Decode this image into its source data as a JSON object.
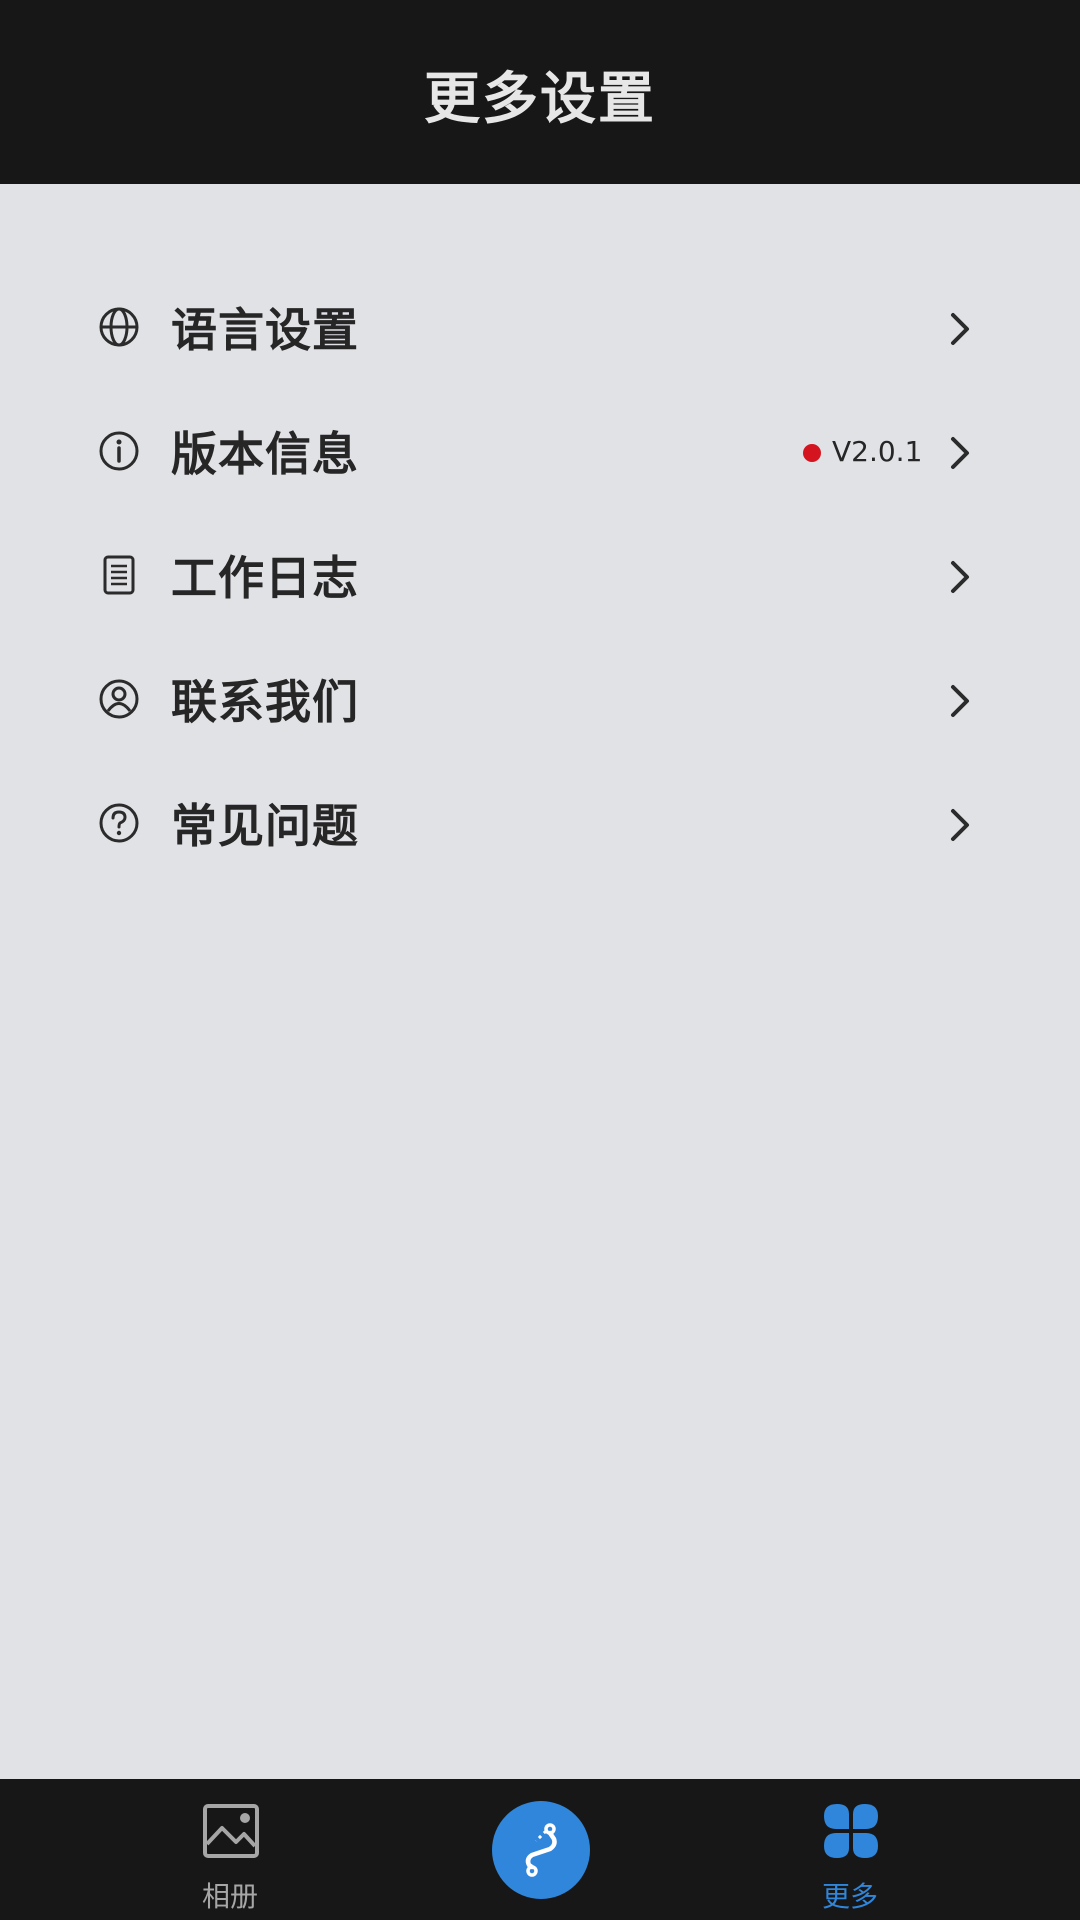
{
  "header": {
    "title": "更多设置"
  },
  "menu": {
    "items": [
      {
        "label": "语言设置",
        "icon": "globe-icon"
      },
      {
        "label": "版本信息",
        "icon": "info-icon",
        "badge_value": "V2.0.1",
        "badge_dot_color": "#d4141f"
      },
      {
        "label": "工作日志",
        "icon": "document-list-icon"
      },
      {
        "label": "联系我们",
        "icon": "person-circle-icon"
      },
      {
        "label": "常见问题",
        "icon": "question-circle-icon"
      }
    ]
  },
  "tabbar": {
    "album_label": "相册",
    "album_icon": "image-icon",
    "center_icon": "route-icon",
    "more_label": "更多",
    "more_icon": "four-leaf-grid-icon",
    "active_color": "#2f86db",
    "inactive_color": "#a6a6a6"
  }
}
